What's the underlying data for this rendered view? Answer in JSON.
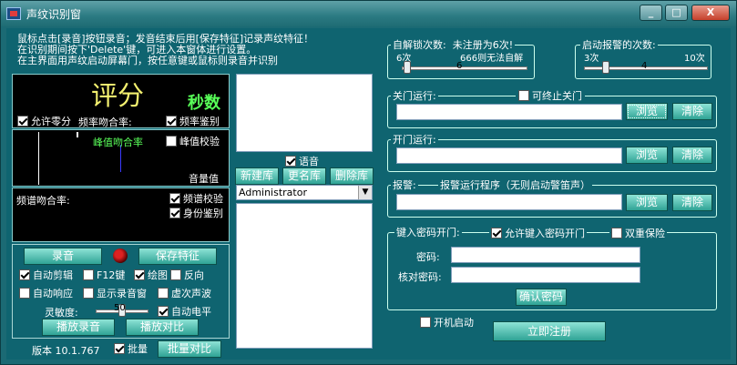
{
  "window": {
    "title": "声纹识别窗",
    "min_label": "_",
    "max_label": "□",
    "close_label": "X"
  },
  "hint": [
    "鼠标点击[录音]按钮录音；发音结束后用[保存特征]记录声纹特征！",
    "在识别期间按下'Delete'键，可进入本窗体进行设置。",
    "在主界面用声纹启动屏幕门，按任意键或鼠标则录音并识别"
  ],
  "score": {
    "title": "评分",
    "secs": "秒数",
    "allow_zero": "允许零分",
    "freq_match": "频率吻合率:",
    "freq_check": "频率鉴别",
    "peak_match": "峰值吻合率",
    "peak_check": "峰值校验",
    "volume": "音量值",
    "spectrum_match": "频谱吻合率:",
    "spectrum_check": "频谱校验",
    "identity_check": "身份鉴别"
  },
  "controls": {
    "record": "录音",
    "save_feature": "保存特征",
    "auto_trim": "自动剪辑",
    "f12": "F12键",
    "plot": "绘图",
    "reverse": "反向",
    "auto_respond": "自动响应",
    "show_window": "显示录音窗",
    "virtual_wave": "虚次声波",
    "sensitivity": "灵敏度:",
    "sensitivity_value": "50",
    "auto_level": "自动电平",
    "play_record": "播放录音",
    "play_compare": "播放对比",
    "version": "版本 10.1.767",
    "batch": "批量",
    "batch_compare": "批量对比"
  },
  "library": {
    "voice": "语音",
    "new": "新建库",
    "rename": "更名库",
    "delete": "删除库",
    "user": "Administrator"
  },
  "unlock": {
    "label": "自解锁次数:",
    "note": "未注册为6次!",
    "min": "6次",
    "max_note": "666则无法自解",
    "value": "6",
    "level": 0.0
  },
  "alarm_count": {
    "label": "启动报警的次数:",
    "min": "3次",
    "max": "10次",
    "value": "4",
    "level": 0.14
  },
  "close_run": {
    "label": "关门运行:",
    "terminate": "可终止关门",
    "browse": "浏览",
    "clear": "清除"
  },
  "open_run": {
    "label": "开门运行:",
    "browse": "浏览",
    "clear": "清除"
  },
  "alarm": {
    "label": "报警:",
    "desc": "报警运行程序（无则启动警笛声）",
    "browse": "浏览",
    "clear": "清除"
  },
  "password": {
    "label": "键入密码开门:",
    "allow": "允许键入密码开门",
    "double": "双重保险",
    "pwd": "密码:",
    "confirm_pwd": "核对密码:",
    "confirm_button": "确认密码"
  },
  "startup": "开机启动",
  "register": "立即注册"
}
